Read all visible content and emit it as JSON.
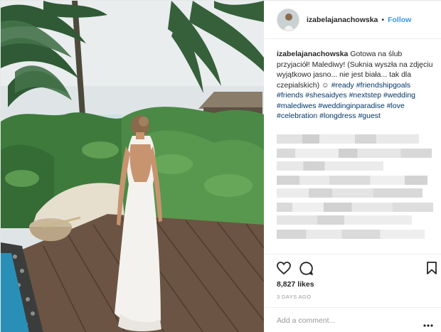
{
  "header": {
    "username": "izabelajanachowska",
    "separator": "•",
    "follow_label": "Follow"
  },
  "caption": {
    "username": "izabelajanachowska",
    "text": "Gotowa na ślub przyjaciół! Malediwy! (Suknia wyszła na zdjęciu wyjątkowo jasno... nie jest biała... tak dla czepialskich)",
    "emoji": "☺",
    "hashtags": [
      "#ready",
      "#friendshipgoals",
      "#friends",
      "#shesaidyes",
      "#nextstep",
      "#wedding",
      "#malediwes",
      "#weddinginparadise",
      "#love",
      "#celebration",
      "#longdress",
      "#guest"
    ]
  },
  "actions": {
    "like_icon": "heart-icon",
    "comment_icon": "comment-icon",
    "save_icon": "bookmark-icon"
  },
  "likes_text": "8,827 likes",
  "age_text": "3 DAYS AGO",
  "comment_box": {
    "placeholder": "Add a comment...",
    "more_icon": "ellipsis-icon"
  },
  "colors": {
    "follow": "#3897f0",
    "hashtag": "#003569",
    "text": "#262626",
    "muted": "#999999",
    "border": "#efefef"
  }
}
